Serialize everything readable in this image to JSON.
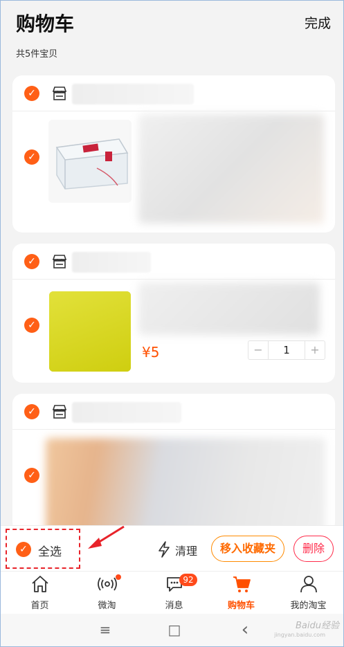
{
  "header": {
    "title": "购物车",
    "action": "完成",
    "count_text": "共5件宝贝"
  },
  "items": [
    {
      "price": "",
      "quantity": ""
    },
    {
      "price": "¥5",
      "quantity": "1",
      "minus": "−",
      "plus": "+"
    },
    {
      "price": "",
      "quantity": ""
    }
  ],
  "bottom_bar": {
    "select_all": "全选",
    "clean": "清理",
    "move_to_favorites": "移入收藏夹",
    "delete": "删除"
  },
  "tabs": [
    {
      "label": "首页",
      "icon": "home-icon"
    },
    {
      "label": "微淘",
      "icon": "broadcast-icon"
    },
    {
      "label": "消息",
      "icon": "message-icon",
      "badge": "92"
    },
    {
      "label": "购物车",
      "icon": "cart-icon",
      "active": true
    },
    {
      "label": "我的淘宝",
      "icon": "user-icon"
    }
  ],
  "system_nav": {
    "menu": "≡",
    "home": "□",
    "back": "‹"
  },
  "watermark": {
    "text": "Baidu经验",
    "sub": "jingyan.baidu.com"
  },
  "colors": {
    "accent": "#ff5000",
    "check": "#ff5f16",
    "highlight_box": "#e8232a"
  }
}
